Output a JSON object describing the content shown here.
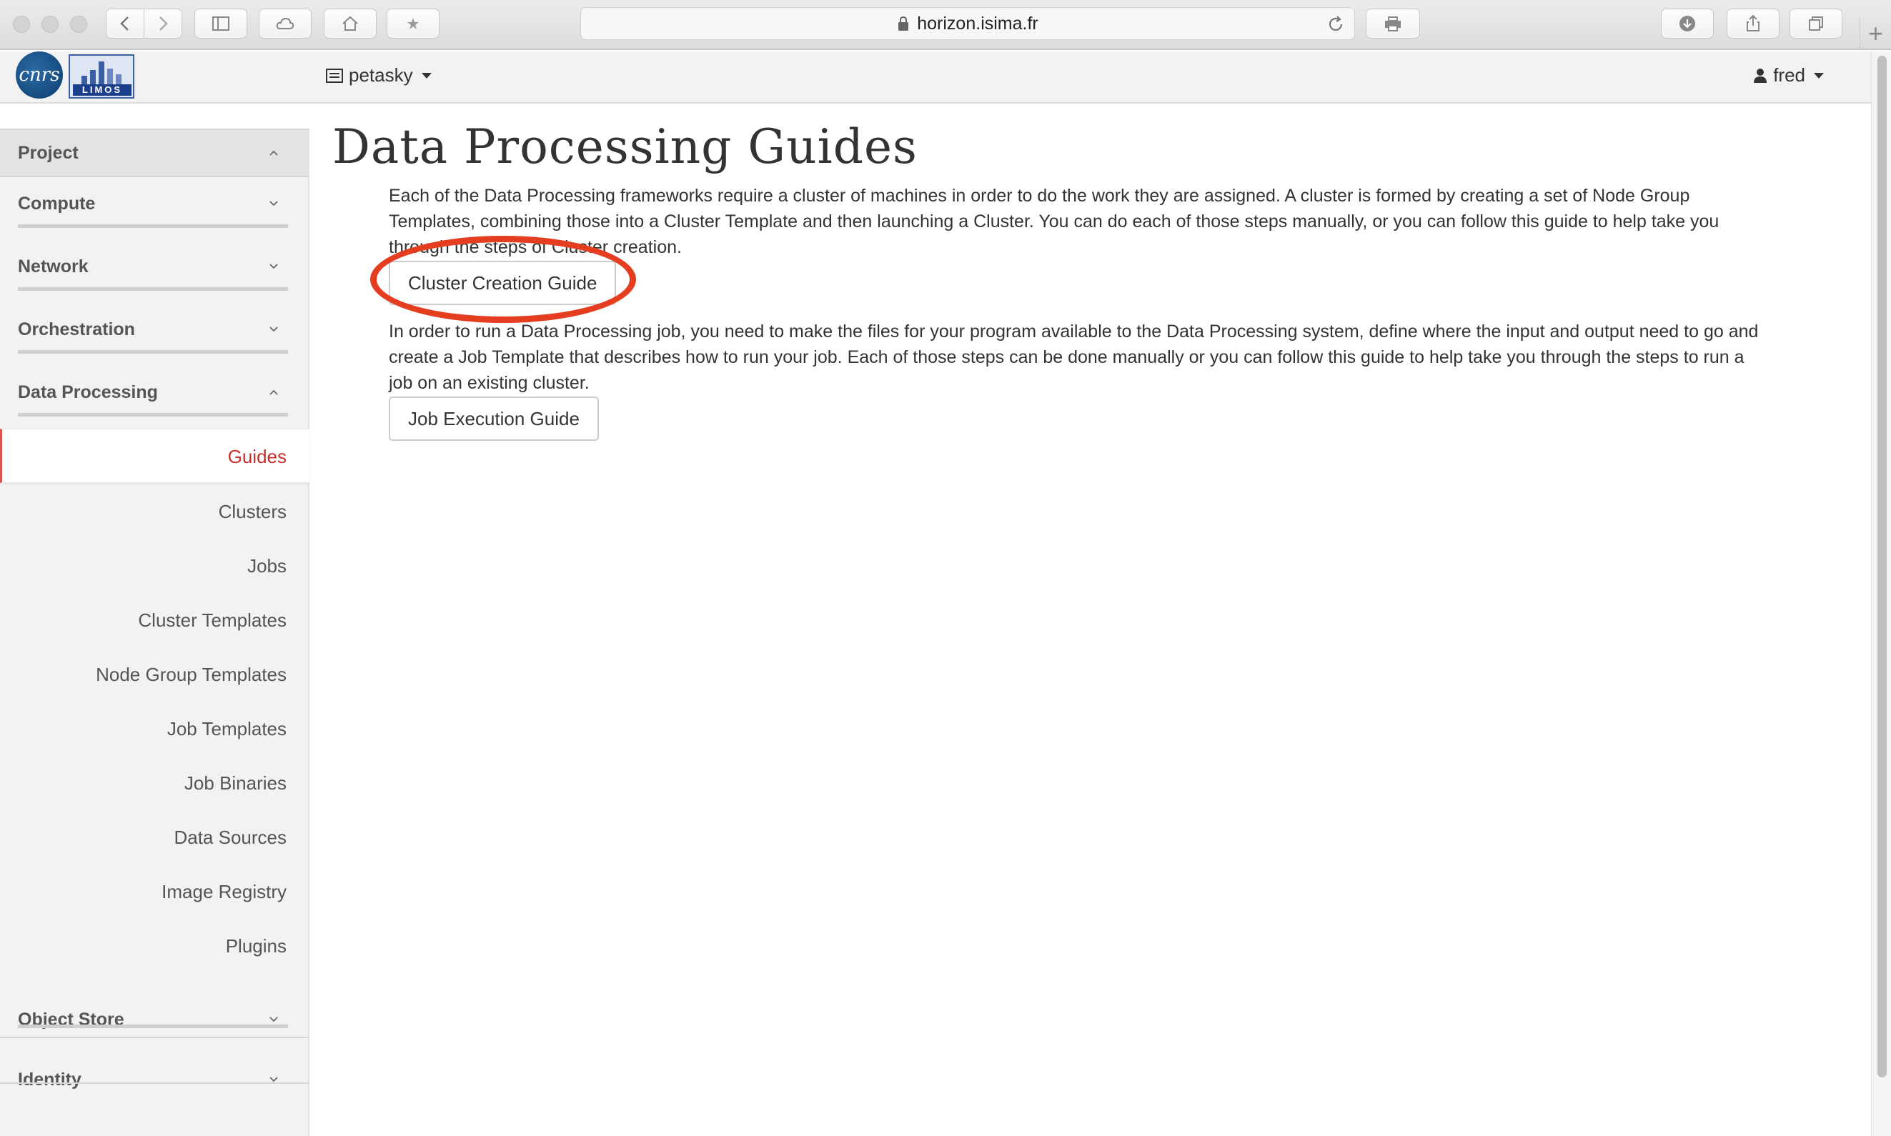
{
  "browser": {
    "url": "horizon.isima.fr",
    "new_tab": "+"
  },
  "header": {
    "logo_cnrs": "cnrs",
    "logo_limos": "LIMOS",
    "project_name": "petasky",
    "user_name": "fred"
  },
  "sidebar": {
    "panels": {
      "project": "Project",
      "compute": "Compute",
      "network": "Network",
      "orchestration": "Orchestration",
      "data_processing": "Data Processing",
      "object_store": "Object Store",
      "identity": "Identity"
    },
    "items": [
      {
        "label": "Guides"
      },
      {
        "label": "Clusters"
      },
      {
        "label": "Jobs"
      },
      {
        "label": "Cluster Templates"
      },
      {
        "label": "Node Group Templates"
      },
      {
        "label": "Job Templates"
      },
      {
        "label": "Job Binaries"
      },
      {
        "label": "Data Sources"
      },
      {
        "label": "Image Registry"
      },
      {
        "label": "Plugins"
      }
    ]
  },
  "main": {
    "title": "Data Processing Guides",
    "cluster_text_1": "Each of the Data Processing frameworks require a cluster of machines in order to do the work they are assigned. A cluster is formed by creating a set of Node Group",
    "cluster_text_2": "Templates, combining those into a Cluster Template and then launching a Cluster. You can do each of those steps manually, or you can follow this guide to help take you",
    "cluster_text_3": "through the steps of Cluster creation.",
    "cluster_button": "Cluster Creation Guide",
    "job_text_1": "In order to run a Data Processing job, you need to make the files for your program available to the Data Processing system, define where the input and output need to go and",
    "job_text_2": "create a Job Template that describes how to run your job. Each of those steps can be done manually or you can follow this guide to help take you through the steps to run a",
    "job_text_3": "job on an existing cluster.",
    "job_button": "Job Execution Guide"
  },
  "colors": {
    "active_nav": "#c9302c",
    "annotation": "#e53d1f",
    "sidebar_bg": "#f2f2f2"
  }
}
